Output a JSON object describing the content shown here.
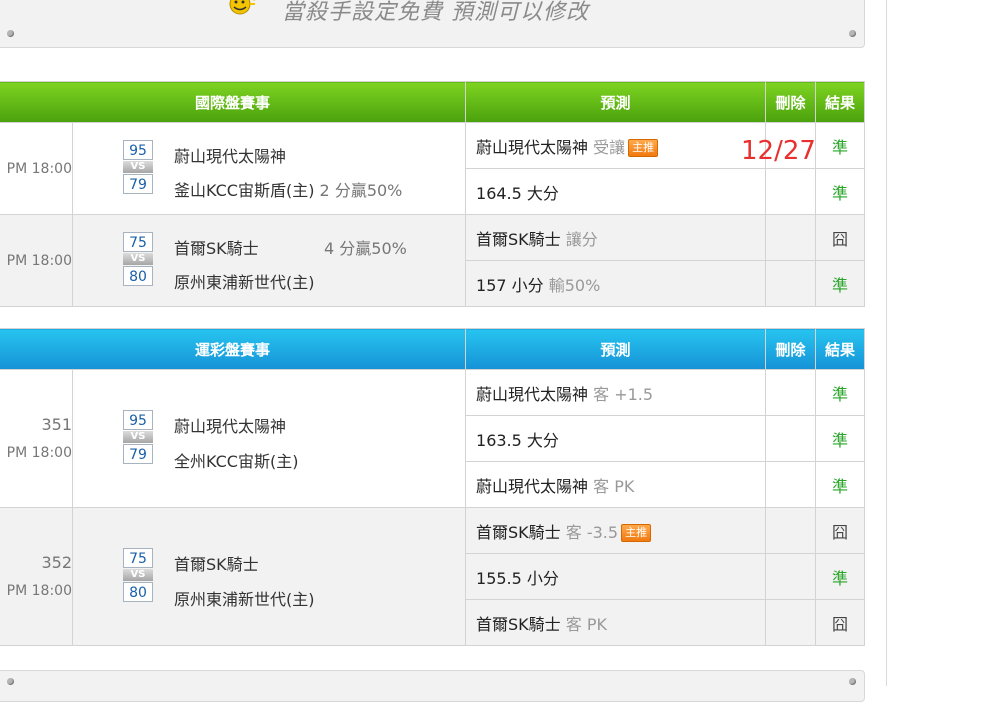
{
  "notice": {
    "text": "當殺手設定免費  預測可以修改",
    "icon": "coin-smiley-icon"
  },
  "date_label": "12/27",
  "headers": {
    "pred": "預測",
    "delete": "刪除",
    "result": "結果"
  },
  "international": {
    "title": "國際盤賽事",
    "games": [
      {
        "time": "PM 18:00",
        "home_score": "95",
        "away_score": "79",
        "vs": "VS",
        "team1": "蔚山現代太陽神",
        "team2": "釜山KCC宙斯盾(主)",
        "team1_extra": "",
        "team2_extra": "2 分贏50%",
        "preds": [
          {
            "main": "蔚山現代太陽神",
            "sub": "受讓",
            "badge": "主推",
            "result": "準"
          },
          {
            "main": "164.5 大分",
            "sub": "",
            "badge": "",
            "result": "準"
          }
        ]
      },
      {
        "time": "PM 18:00",
        "home_score": "75",
        "away_score": "80",
        "vs": "VS",
        "team1": "首爾SK騎士",
        "team2": "原州東浦新世代(主)",
        "team1_extra": "4 分贏50%",
        "team2_extra": "",
        "preds": [
          {
            "main": "首爾SK騎士",
            "sub": "讓分",
            "badge": "",
            "result": "囧"
          },
          {
            "main": "157 小分",
            "sub": "輸50%",
            "badge": "",
            "result": "準"
          }
        ]
      }
    ]
  },
  "sports_lottery": {
    "title": "運彩盤賽事",
    "games": [
      {
        "num": "351",
        "time": "PM 18:00",
        "home_score": "95",
        "away_score": "79",
        "vs": "VS",
        "team1": "蔚山現代太陽神",
        "team2": "全州KCC宙斯(主)",
        "preds": [
          {
            "main": "蔚山現代太陽神",
            "sub": "客 +1.5",
            "badge": "",
            "result": "準"
          },
          {
            "main": "163.5 大分",
            "sub": "",
            "badge": "",
            "result": "準"
          },
          {
            "main": "蔚山現代太陽神",
            "sub": "客 PK",
            "badge": "",
            "result": "準"
          }
        ]
      },
      {
        "num": "352",
        "time": "PM 18:00",
        "home_score": "75",
        "away_score": "80",
        "vs": "VS",
        "team1": "首爾SK騎士",
        "team2": "原州東浦新世代(主)",
        "preds": [
          {
            "main": "首爾SK騎士",
            "sub": "客 -3.5",
            "badge": "主推",
            "result": "囧"
          },
          {
            "main": "155.5 小分",
            "sub": "",
            "badge": "",
            "result": "準"
          },
          {
            "main": "首爾SK騎士",
            "sub": "客 PK",
            "badge": "",
            "result": "囧"
          }
        ]
      }
    ]
  },
  "colors": {
    "green_header": "#5bb215",
    "blue_header": "#1ca4e0",
    "ok": "#2aa52a",
    "date": "#e8312f",
    "badge": "#f08a20"
  }
}
